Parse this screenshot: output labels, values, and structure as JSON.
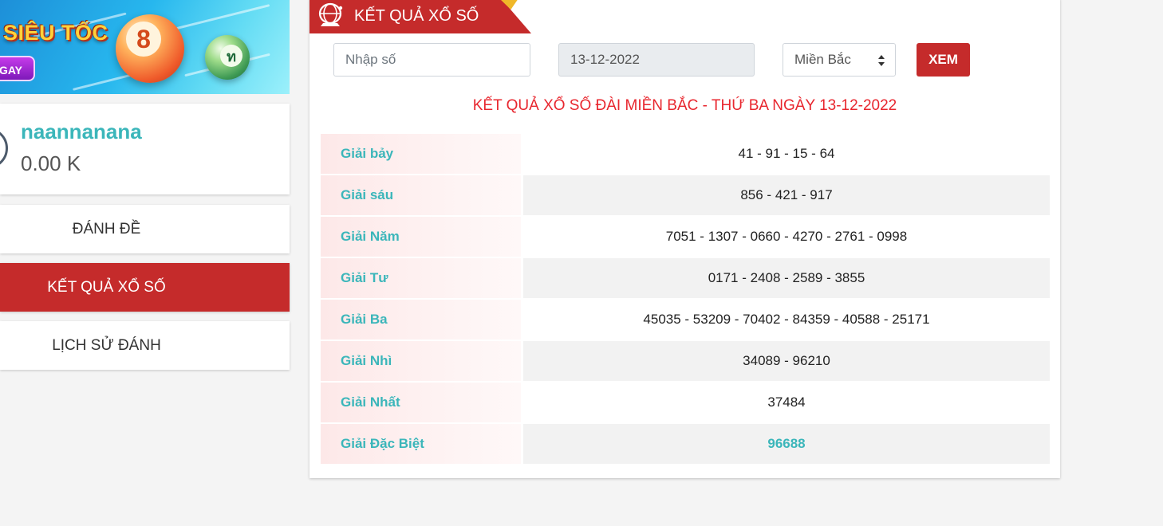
{
  "banner": {
    "title": "SIÊU TỐC",
    "button_label": "GAY",
    "ball_orange_number": "8",
    "ball_green_number": "ท"
  },
  "user": {
    "name": "naannanana",
    "balance": "0.00 K"
  },
  "sidebar": {
    "items": [
      {
        "label": "ĐÁNH ĐỀ",
        "active": false
      },
      {
        "label": "KẾT QUẢ XỔ SỐ",
        "active": true
      },
      {
        "label": "LỊCH SỬ ĐÁNH",
        "active": false
      }
    ]
  },
  "panel": {
    "title": "KẾT QUẢ XỔ SỐ",
    "search_placeholder": "Nhập số",
    "date_value": "13-12-2022",
    "region_selected": "Miền Bắc",
    "view_button": "XEM",
    "result_heading": "KẾT QUẢ XỔ SỐ ĐÀI MIỀN BẮC - THỨ BA NGÀY 13-12-2022"
  },
  "results": [
    {
      "label": "Giải bảy",
      "numbers": "41 - 91 - 15 - 64"
    },
    {
      "label": "Giải sáu",
      "numbers": "856 - 421 - 917"
    },
    {
      "label": "Giải Năm",
      "numbers": "7051 - 1307 - 0660 - 4270 - 2761 - 0998"
    },
    {
      "label": "Giải Tư",
      "numbers": "0171 - 2408 - 2589 - 3855"
    },
    {
      "label": "Giải Ba",
      "numbers": "45035 - 53209 - 70402 - 84359 - 40588 - 25171"
    },
    {
      "label": "Giải Nhì",
      "numbers": "34089 - 96210"
    },
    {
      "label": "Giải Nhất",
      "numbers": "37484"
    },
    {
      "label": "Giải Đặc Biệt",
      "numbers": "96688"
    }
  ],
  "colors": {
    "accent_red": "#c52b2b",
    "heading_red": "#e8262e",
    "teal": "#3bb6ba"
  },
  "icons": {
    "ribbon": "lottery-cage-icon",
    "select": "sort-caret-icon"
  }
}
